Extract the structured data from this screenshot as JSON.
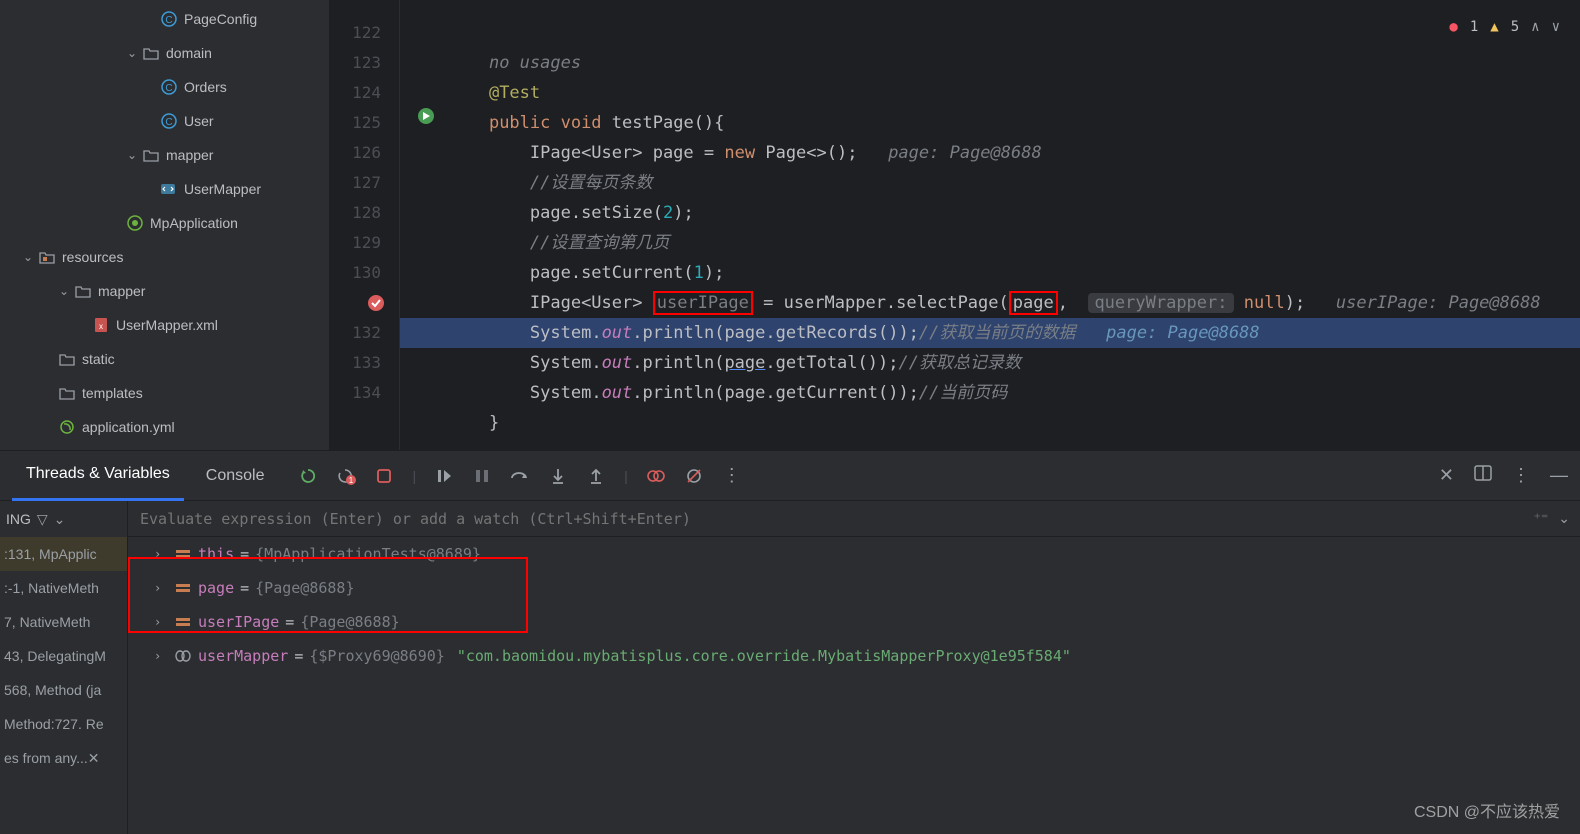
{
  "tree": {
    "pageconfig": "PageConfig",
    "domain": "domain",
    "orders": "Orders",
    "user": "User",
    "mapper": "mapper",
    "usermapper": "UserMapper",
    "mpapp": "MpApplication",
    "resources": "resources",
    "mapper2": "mapper",
    "usermapperxml": "UserMapper.xml",
    "static": "static",
    "templates": "templates",
    "appyml": "application.yml"
  },
  "gutter": [
    "122",
    "123",
    "124",
    "125",
    "126",
    "127",
    "128",
    "129",
    "130",
    "",
    "132",
    "133",
    "134"
  ],
  "status": {
    "err": "1",
    "warn": "5"
  },
  "code": {
    "nousages": "no usages",
    "c1": "//设置每页条数",
    "c2": "//设置查询第几页",
    "c3": "//获取当前页的数据",
    "c4": "//获取总记录数",
    "c5": "//当前页码",
    "hint_page1": "page: Page@8688",
    "hint_qw": "queryWrapper:",
    "hint_page2": "userIPage: Page@8688",
    "hint_page3": "page: Page@8688"
  },
  "debug": {
    "tab1": "Threads & Variables",
    "tab2": "Console",
    "frames_label": "ING",
    "frames": [
      ":131, MpApplic",
      ":-1, NativeMeth",
      "7, NativeMeth",
      "43, DelegatingM",
      "568, Method (ja",
      "Method:727. Re"
    ],
    "frames_last": "es from any...",
    "eval_placeholder": "Evaluate expression (Enter) or add a watch (Ctrl+Shift+Enter)",
    "vars": {
      "this_name": "this",
      "this_val": "{MpApplicationTests@8689}",
      "page_name": "page",
      "page_val": "{Page@8688}",
      "uip_name": "userIPage",
      "uip_val": "{Page@8688}",
      "um_name": "userMapper",
      "um_val": "{$Proxy69@8690}",
      "um_str": "\"com.baomidou.mybatisplus.core.override.MybatisMapperProxy@1e95f584\""
    }
  },
  "watermark": "CSDN @不应该热爱"
}
